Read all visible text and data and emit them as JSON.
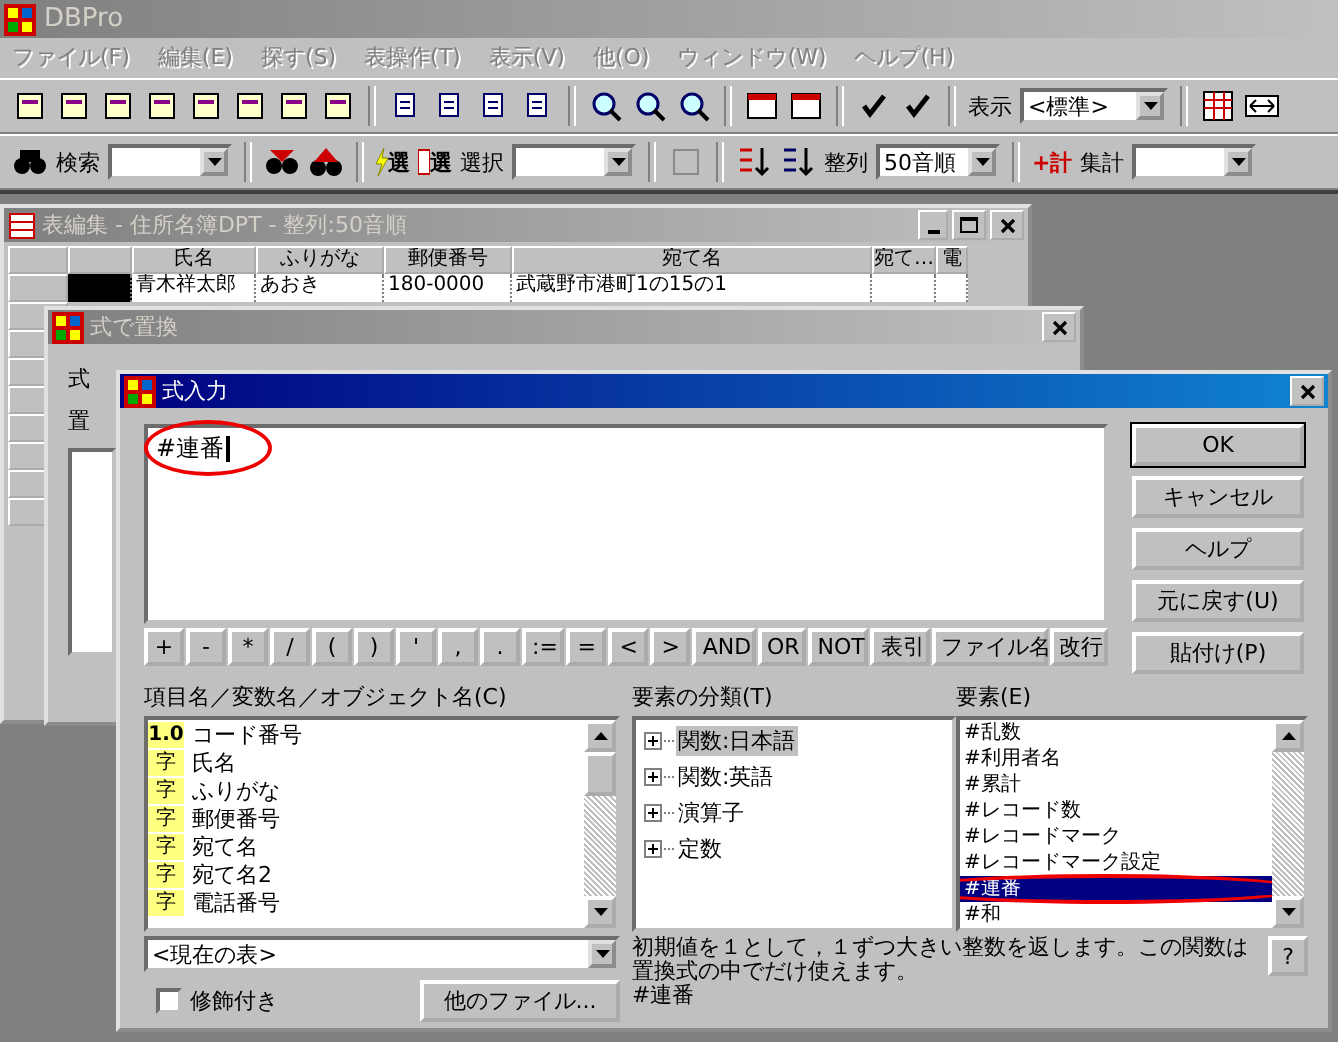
{
  "app": {
    "title": "DBPro",
    "active": false
  },
  "menu": [
    {
      "label": "ファイル(F)",
      "disabled": true
    },
    {
      "label": "編集(E)",
      "disabled": true
    },
    {
      "label": "探す(S)",
      "disabled": true
    },
    {
      "label": "表操作(T)",
      "disabled": true
    },
    {
      "label": "表示(V)",
      "disabled": true
    },
    {
      "label": "他(O)",
      "disabled": true
    },
    {
      "label": "ウィンドウ(W)",
      "disabled": true
    },
    {
      "label": "ヘルプ(H)",
      "disabled": true
    }
  ],
  "toolbar1": {
    "view_label": "表示",
    "view_value": "<標準>"
  },
  "toolbar2": {
    "search_label": "検索",
    "select_icon_texts": [
      "選",
      "選"
    ],
    "select_label": "選択",
    "sort_label": "整列",
    "sort_value": "50音順",
    "total_icon_text": "+計",
    "total_label": "集計"
  },
  "table_window": {
    "title": "表編集 - 住所名簿DPT - 整列:50音順",
    "active": false,
    "columns": [
      "氏名",
      "ふりがな",
      "郵便番号",
      "宛て名",
      "宛て…",
      "電"
    ],
    "rows": [
      {
        "cells": [
          "青木祥太郎",
          "あおき",
          "180-0000",
          "武蔵野市港町1の15の1",
          "",
          ""
        ]
      }
    ]
  },
  "replace_dialog": {
    "title": "式で置換",
    "active": false,
    "labels": [
      "式",
      "置"
    ]
  },
  "formula_dialog": {
    "title": "式入力",
    "active": true,
    "expression": "#連番",
    "buttons": [
      "OK",
      "キャンセル",
      "ヘルプ",
      "元に戻す(U)",
      "貼付け(P)"
    ],
    "operators": [
      "+",
      "-",
      "*",
      "/",
      "(",
      ")",
      "'",
      ",",
      ".",
      ":=",
      "=",
      "<",
      ">",
      "AND",
      "OR",
      "NOT",
      "表引",
      "ファイル名",
      "改行"
    ],
    "fields_label": "項目名／変数名／オブジェクト名(C)",
    "fields": [
      {
        "type": "1.0",
        "name": "コード番号"
      },
      {
        "type": "字",
        "name": "氏名"
      },
      {
        "type": "字",
        "name": "ふりがな"
      },
      {
        "type": "字",
        "name": "郵便番号"
      },
      {
        "type": "字",
        "name": "宛て名"
      },
      {
        "type": "字",
        "name": "宛て名2"
      },
      {
        "type": "字",
        "name": "電話番号"
      }
    ],
    "table_combo": "<現在の表>",
    "decorated": {
      "label": "修飾付き",
      "checked": false
    },
    "other_files_button": "他のファイル...",
    "categories_label": "要素の分類(T)",
    "categories": [
      {
        "label": "関数:日本語",
        "selected": true
      },
      {
        "label": "関数:英語",
        "selected": false
      },
      {
        "label": "演算子",
        "selected": false
      },
      {
        "label": "定数",
        "selected": false
      }
    ],
    "elements_label": "要素(E)",
    "elements": [
      {
        "label": "#乱数",
        "selected": false
      },
      {
        "label": "#利用者名",
        "selected": false
      },
      {
        "label": "#累計",
        "selected": false
      },
      {
        "label": "#レコード数",
        "selected": false
      },
      {
        "label": "#レコードマーク",
        "selected": false
      },
      {
        "label": "#レコードマーク設定",
        "selected": false
      },
      {
        "label": "#連番",
        "selected": true
      },
      {
        "label": "#和",
        "selected": false
      }
    ],
    "description": "初期値を１として，１ずつ大きい整数を返します。この関数は置換式の中でだけ使えます。",
    "description_name": "#連番",
    "help_button": "?"
  }
}
